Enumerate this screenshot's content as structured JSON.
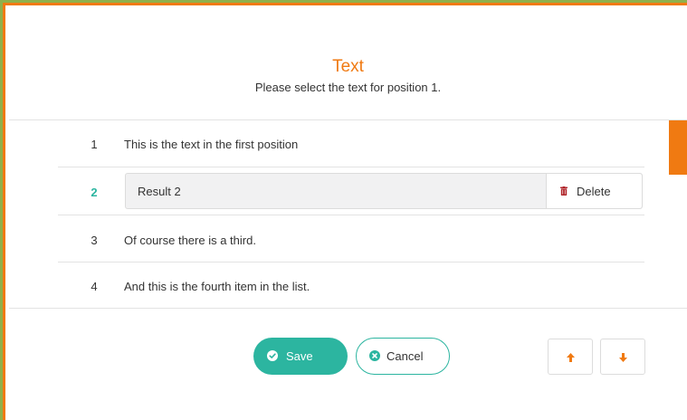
{
  "colors": {
    "accent_orange": "#f07a12",
    "accent_teal": "#2cb5a0",
    "frame_green": "#8fb04b",
    "danger_red": "#b0252a"
  },
  "header": {
    "title": "Text",
    "subtitle": "Please select the text for position 1."
  },
  "list": {
    "rows": [
      {
        "number": "1",
        "text": "This is the text in the first position"
      },
      {
        "number": "2",
        "text": "Result 2",
        "delete_label": "Delete",
        "icon": "trash-icon"
      },
      {
        "number": "3",
        "text": "Of course there is a third."
      },
      {
        "number": "4",
        "text": "And this is the fourth item in the list."
      }
    ]
  },
  "footer": {
    "save_label": "Save",
    "save_icon": "check-circle-icon",
    "cancel_label": "Cancel",
    "cancel_icon": "x-circle-icon",
    "move_up_icon": "arrow-up-icon",
    "move_down_icon": "arrow-down-icon"
  }
}
